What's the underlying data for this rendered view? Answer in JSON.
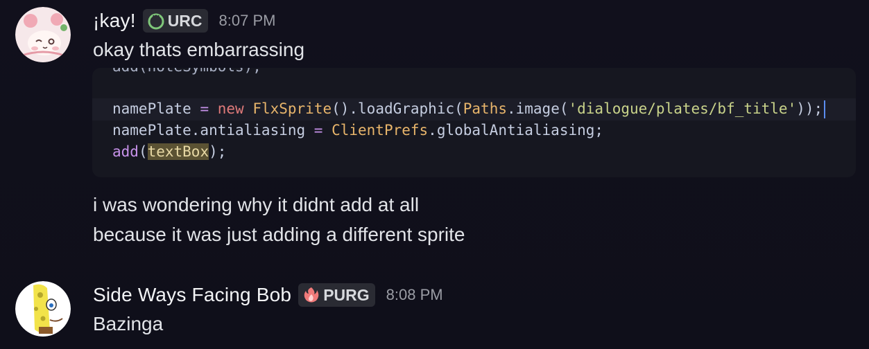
{
  "messages": [
    {
      "username": "¡kay!",
      "tag": "URC",
      "timestamp": "8:07 PM",
      "text": "okay thats embarrassing",
      "code": {
        "line_cut": "add(noteSymbols);",
        "line1": {
          "a": "namePlate",
          "b": " = ",
          "c": "new",
          "d": " FlxSprite",
          "e": "().loadGraphic(",
          "f": "Paths",
          "g": ".image(",
          "h": "'dialogue/plates/bf_title'",
          "i": "));"
        },
        "line2": {
          "a": "namePlate.antialiasing",
          "b": " = ",
          "c": "ClientPrefs",
          "d": ".globalAntialiasing;"
        },
        "line3": {
          "a": "add",
          "b": "(",
          "c": "textBox",
          "d": ");"
        }
      },
      "followups": [
        "i was wondering why it didnt add at all",
        "because it was just adding a different sprite"
      ]
    },
    {
      "username": "Side Ways Facing Bob",
      "tag": "PURG",
      "timestamp": "8:08 PM",
      "text": "Bazinga"
    }
  ],
  "colors": {
    "background": "#0f0f18",
    "code_background": "#161720",
    "tag_background": "#2a2b33",
    "timestamp": "#9a9ca4"
  }
}
